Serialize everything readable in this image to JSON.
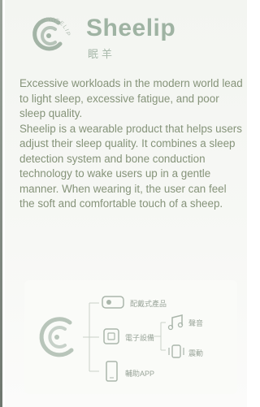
{
  "brand": {
    "name": "Sheelip",
    "subtitle": "眠羊",
    "logo_ring_text": "SHEELIP"
  },
  "description": {
    "paragraph1": "Excessive workloads in the modern world lead to light sleep, excessive fatigue, and poor sleep quality.",
    "paragraph2": "Sheelip is a wearable product that helps users adjust their sleep quality. It combines a sleep detection system and bone conduction technology to wake users up in a gentle manner. When wearing it, the user can feel the soft and comfortable touch of a sheep."
  },
  "diagram": {
    "logo_ring_text": "SHEELIP",
    "items": {
      "wearable": "配戴式產品",
      "electronic": "電子設備",
      "app": "輔助APP",
      "music": "聲音",
      "vibration": "震動"
    },
    "icons": [
      "sheelip-logo-icon",
      "wearable-device-icon",
      "electronic-device-icon",
      "smartphone-icon",
      "music-note-icon",
      "vibration-icon"
    ]
  },
  "colors": {
    "brand_green": "#9fb3a3",
    "text_green": "#859379",
    "background": "#f5f7f3"
  }
}
